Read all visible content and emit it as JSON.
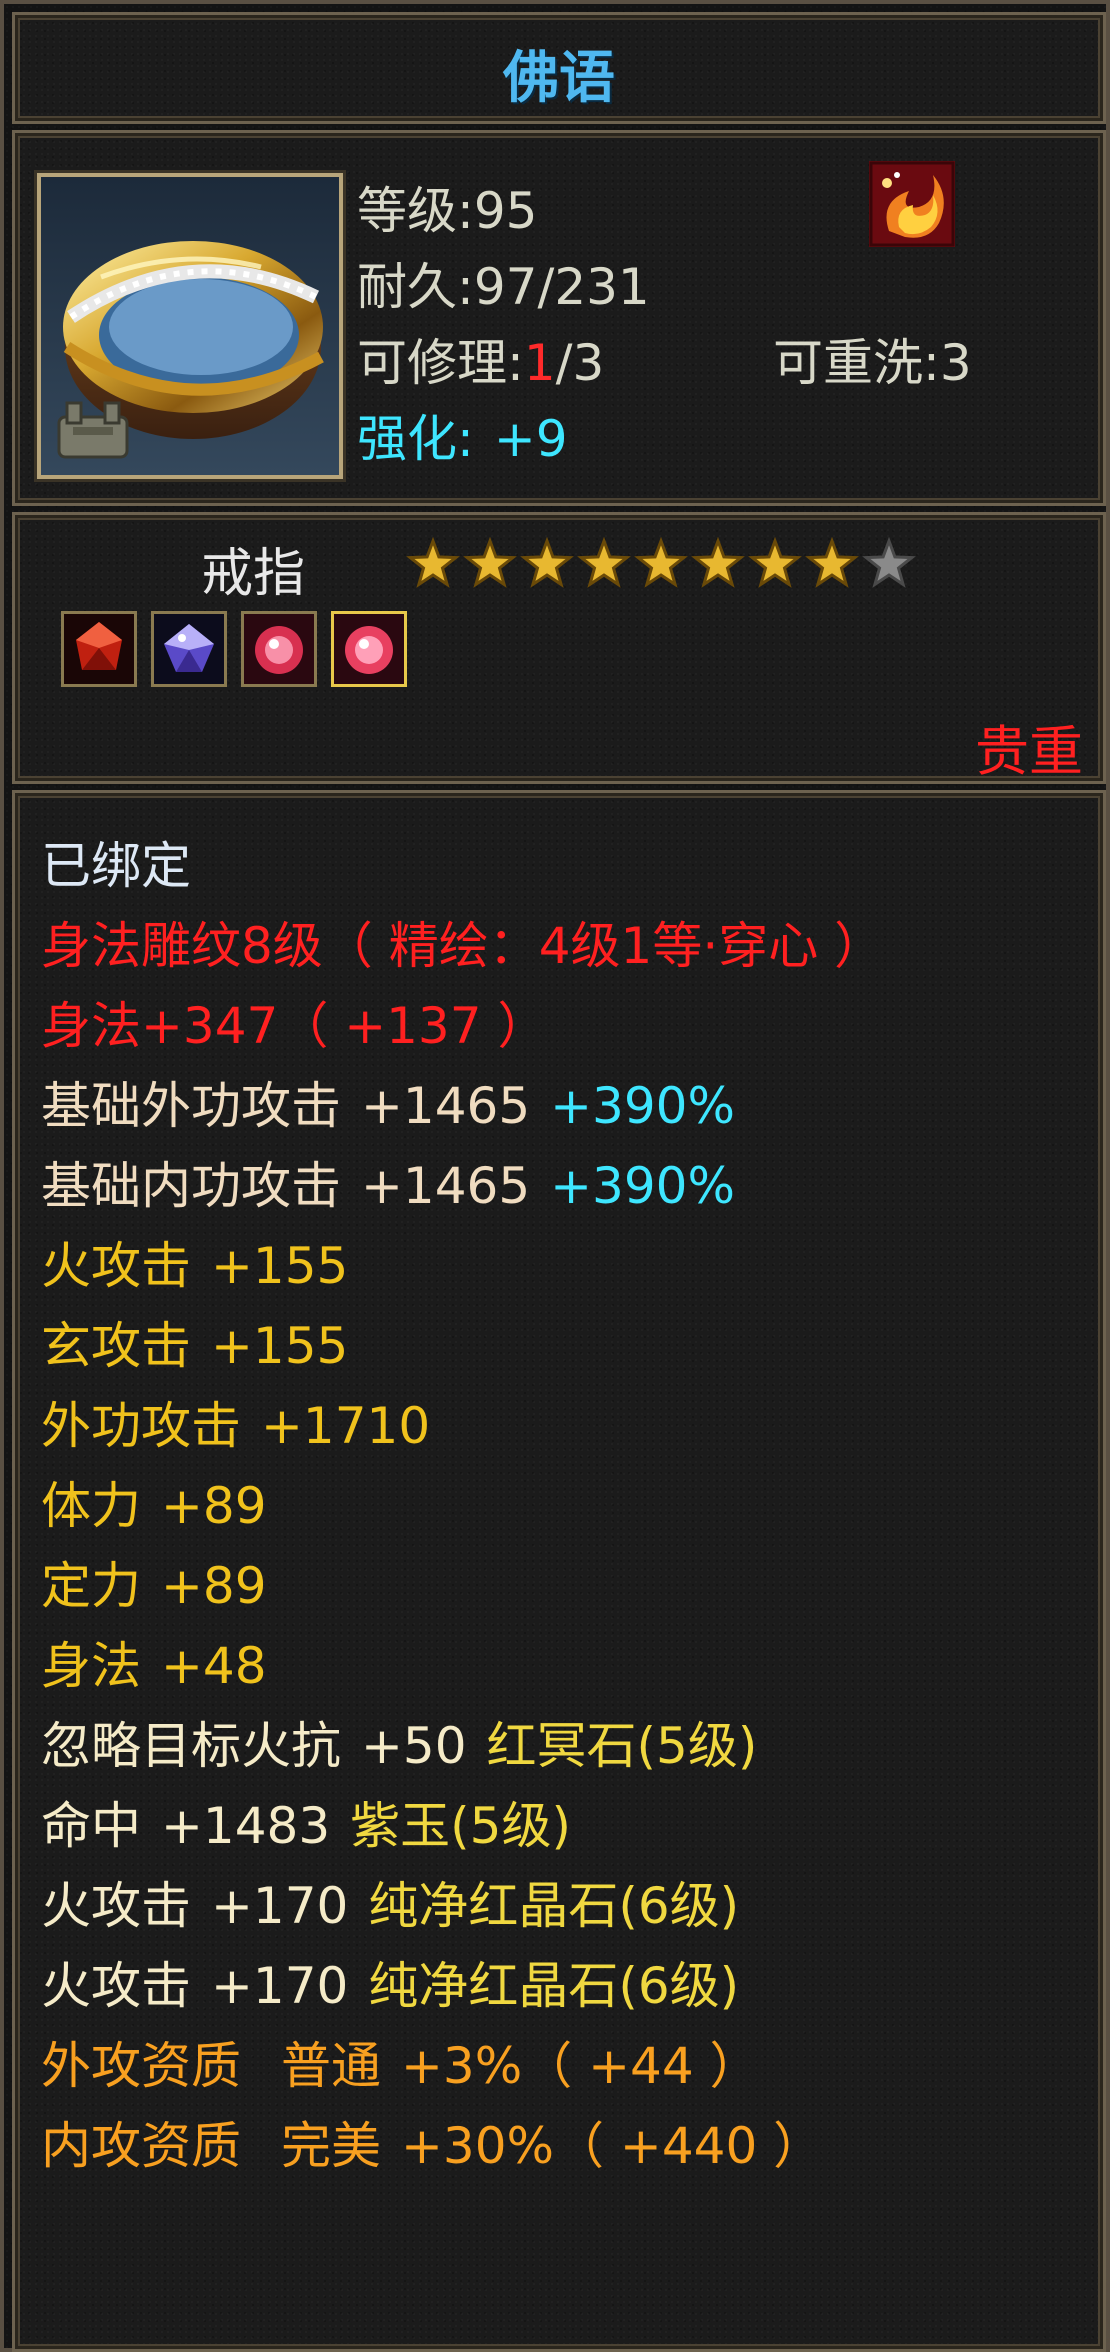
{
  "title": "佛语",
  "colors": {
    "title": "#4fb8f0",
    "enhance": "#3ee6ff",
    "precious": "#ff2020",
    "bound": "#dde8f5",
    "engrave": "#ff2020",
    "base_attack": "#f0dcc0",
    "percent": "#3ee6ff",
    "attribute": "#f0c21c",
    "gem_stat": "#f5ebc8",
    "gem_name": "#f0d840",
    "quality": "#f8a020"
  },
  "item": {
    "icon": "gold-ring-icon",
    "badge_icon": "bind-lock-icon",
    "buff_icon": "phoenix-flame-icon",
    "level": "等级:95",
    "durability": "耐久:97/231",
    "repair_prefix": "可修理:",
    "repair_used": "1",
    "repair_total": "/3",
    "rewash": "可重洗:3",
    "enhance_label": "强化:",
    "enhance_value": "+9"
  },
  "type": "戒指",
  "stars": {
    "total": 9,
    "filled": 8
  },
  "gems": [
    {
      "icon": "red-crystal-gem-icon",
      "color": "#d0281a"
    },
    {
      "icon": "purple-jade-gem-icon",
      "color": "#7a6ad8"
    },
    {
      "icon": "pure-red-crystal-gem-icon",
      "color": "#e84060"
    },
    {
      "icon": "pure-red-crystal-gem-icon",
      "color": "#f05070"
    }
  ],
  "precious": "贵重",
  "stats": {
    "bound": "已绑定",
    "engrave": "身法雕纹8级（ 精绘：4级1等·穿心 ）",
    "agility_bonus": "身法+347（ +137 ）",
    "base_outer": {
      "label": "基础外功攻击",
      "value": "+1465",
      "percent": "+390%"
    },
    "base_inner": {
      "label": "基础内功攻击",
      "value": "+1465",
      "percent": "+390%"
    },
    "attrs": [
      {
        "label": "火攻击",
        "value": "+155"
      },
      {
        "label": "玄攻击",
        "value": "+155"
      },
      {
        "label": "外功攻击",
        "value": "+1710"
      },
      {
        "label": "体力",
        "value": "+89"
      },
      {
        "label": "定力",
        "value": "+89"
      },
      {
        "label": "身法",
        "value": "+48"
      }
    ],
    "gem_stats": [
      {
        "label": "忽略目标火抗",
        "value": "+50",
        "gem": "红冥石(5级)"
      },
      {
        "label": "命中",
        "value": "+1483",
        "gem": "紫玉(5级)"
      },
      {
        "label": "火攻击",
        "value": "+170",
        "gem": "纯净红晶石(6级)"
      },
      {
        "label": "火攻击",
        "value": "+170",
        "gem": "纯净红晶石(6级)"
      }
    ],
    "qualities": [
      {
        "label": "外攻资质",
        "grade": "普通",
        "value": "+3%",
        "bonus": "（ +44 ）"
      },
      {
        "label": "内攻资质",
        "grade": "完美",
        "value": "+30%",
        "bonus": "（ +440 ）"
      }
    ]
  }
}
